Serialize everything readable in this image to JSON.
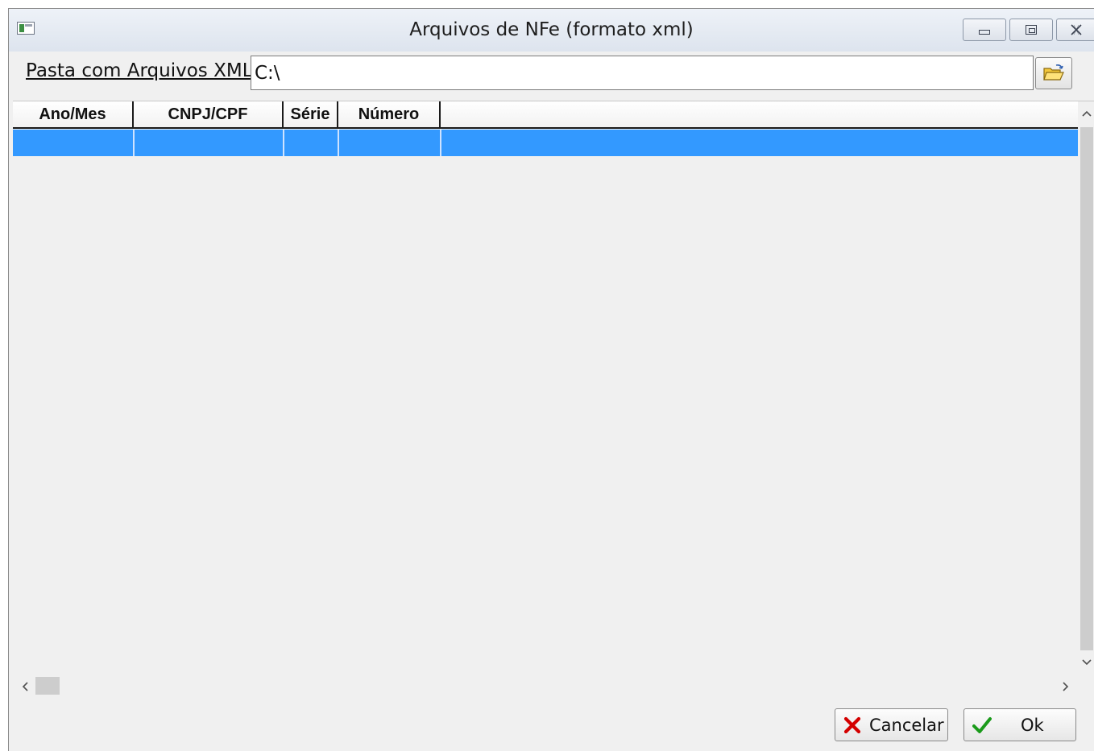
{
  "window": {
    "title": "Arquivos de NFe (formato xml)"
  },
  "folder": {
    "label": "Pasta com Arquivos XML",
    "value": "C:\\"
  },
  "grid": {
    "columns": [
      "Ano/Mes",
      "CNPJ/CPF",
      "Série",
      "Número",
      ""
    ],
    "selected_row": [
      "",
      "",
      "",
      "",
      ""
    ]
  },
  "buttons": {
    "cancel_label": "Cancelar",
    "ok_label": "Ok"
  },
  "icons": {
    "app": "app-window-icon",
    "minimize": "minimize-icon",
    "maximize": "maximize-icon",
    "close": "close-icon",
    "browse": "open-folder-icon",
    "cancel": "red-x-icon",
    "ok": "green-check-icon"
  },
  "colors": {
    "selection": "#3399ff",
    "cancel_icon": "#d40000",
    "ok_icon": "#1a9a1a",
    "folder_icon": "#f3c73a"
  }
}
